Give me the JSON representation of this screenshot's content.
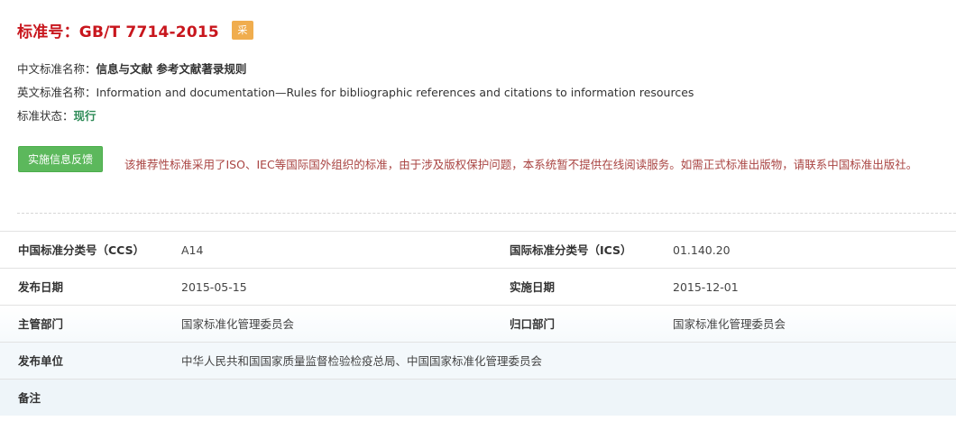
{
  "header": {
    "title": "标准号：GB/T 7714-2015",
    "badge": "采"
  },
  "info": {
    "cn_name_label": "中文标准名称：",
    "cn_name_value": "信息与文献 参考文献著录规则",
    "en_name_label": "英文标准名称：",
    "en_name_value": "Information and documentation—Rules for bibliographic references and citations to information resources",
    "status_label": "标准状态：",
    "status_value": "现行"
  },
  "feedback_button": "实施信息反馈",
  "notice": "该推荐性标准采用了ISO、IEC等国际国外组织的标准，由于涉及版权保护问题，本系统暂不提供在线阅读服务。如需正式标准出版物，请联系中国标准出版社。",
  "table": {
    "ccs_label": "中国标准分类号（CCS）",
    "ccs_value": "A14",
    "ics_label": "国际标准分类号（ICS）",
    "ics_value": "01.140.20",
    "publish_date_label": "发布日期",
    "publish_date_value": "2015-05-15",
    "implement_date_label": "实施日期",
    "implement_date_value": "2015-12-01",
    "dept_label": "主管部门",
    "dept_value": "国家标准化管理委员会",
    "admin_label": "归口部门",
    "admin_value": "国家标准化管理委员会",
    "issuer_label": "发布单位",
    "issuer_value": "中华人民共和国国家质量监督检验检疫总局、中国国家标准化管理委员会",
    "remark_label": "备注",
    "remark_value": ""
  }
}
